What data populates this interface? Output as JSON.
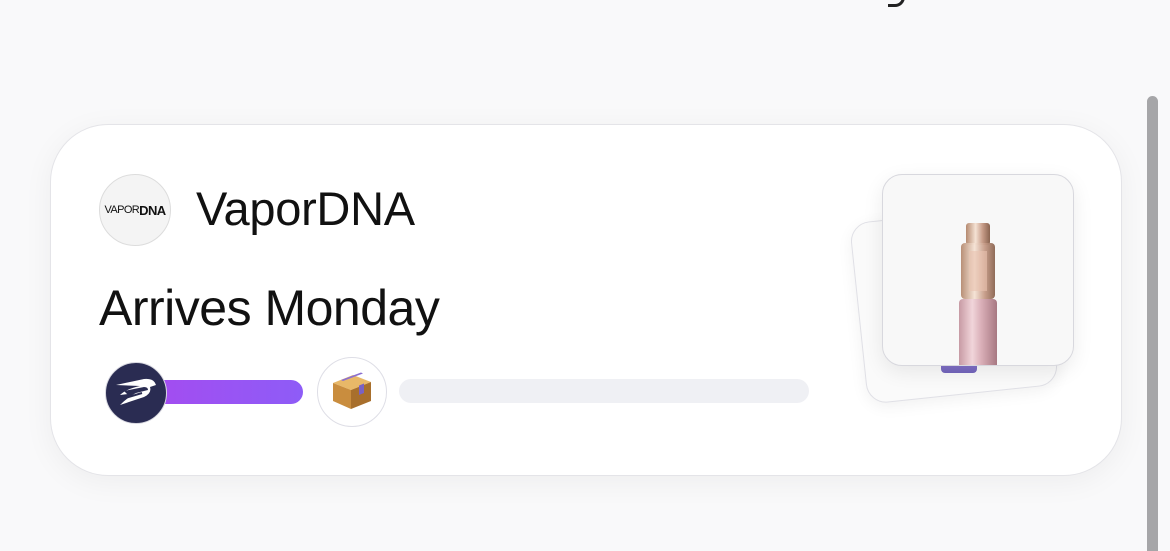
{
  "merchant": {
    "logo_text_thin": "VAPOR",
    "logo_text_bold": "DNA",
    "logo_icon": "vapordna-logo",
    "name": "VaporDNA"
  },
  "order": {
    "eta": "Arrives Monday",
    "carrier_icon": "usps-eagle-icon",
    "destination_icon": "package-icon",
    "progress_fraction": 0.27
  },
  "product": {
    "image_icon": "vape-device-image"
  },
  "colors": {
    "progress_fill_start": "#a44cf0",
    "progress_fill_end": "#8e5cf7",
    "progress_track": "#eff0f4",
    "carrier_bg": "#2a2c52"
  }
}
